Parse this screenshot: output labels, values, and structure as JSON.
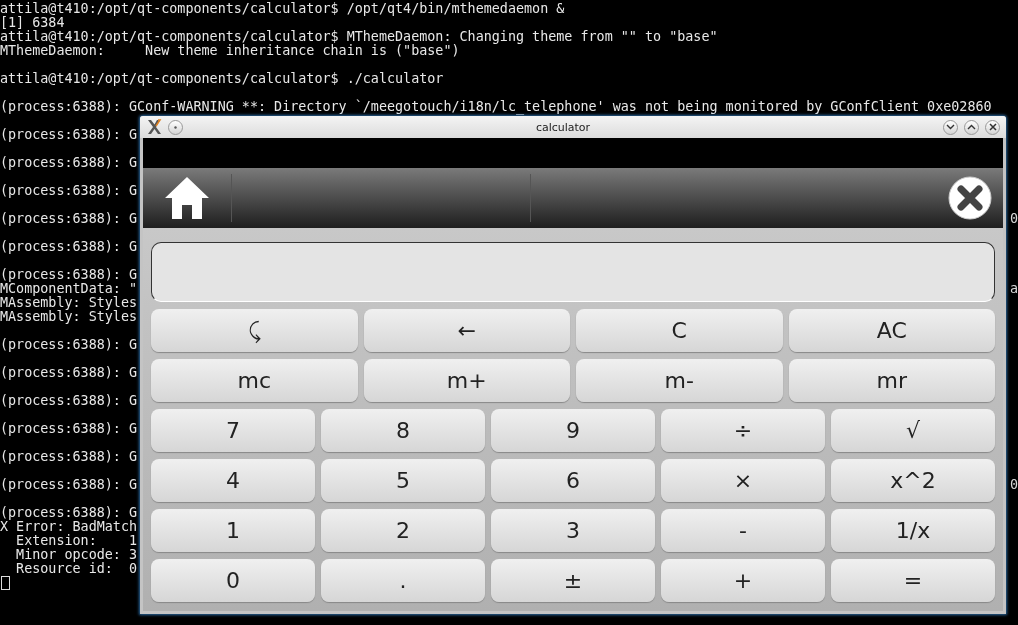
{
  "terminal": {
    "lines": [
      {
        "kind": "text",
        "text": "attila@t410:/opt/qt-components/calculator$ /opt/qt4/bin/mthemedaemon &"
      },
      {
        "kind": "text",
        "text": "[1] 6384"
      },
      {
        "kind": "text",
        "text": "attila@t410:/opt/qt-components/calculator$ MThemeDaemon: Changing theme from \"\" to \"base\""
      },
      {
        "kind": "text",
        "text": "MThemeDaemon:     New theme inheritance chain is (\"base\")"
      },
      {
        "kind": "blank"
      },
      {
        "kind": "text",
        "text": "attila@t410:/opt/qt-components/calculator$ ./calculator"
      },
      {
        "kind": "blank"
      },
      {
        "kind": "text",
        "text": "(process:6388): GConf-WARNING **: Directory `/meegotouch/i18n/lc_telephone' was not being monitored by GConfClient 0xe02860"
      },
      {
        "kind": "blank"
      },
      {
        "kind": "text",
        "text": "(process:6388): G"
      },
      {
        "kind": "blank"
      },
      {
        "kind": "text",
        "text": "(process:6388): G"
      },
      {
        "kind": "blank"
      },
      {
        "kind": "text",
        "text": "(process:6388): G"
      },
      {
        "kind": "blank"
      },
      {
        "kind": "text",
        "text": "(process:6388): G",
        "tail": "0"
      },
      {
        "kind": "blank"
      },
      {
        "kind": "text",
        "text": "(process:6388): G"
      },
      {
        "kind": "blank"
      },
      {
        "kind": "text",
        "text": "(process:6388): G"
      },
      {
        "kind": "text",
        "text": "MComponentData: \"",
        "tail": "a"
      },
      {
        "kind": "text",
        "text": "MAssembly: Styles"
      },
      {
        "kind": "text",
        "text": "MAssembly: Styles"
      },
      {
        "kind": "blank"
      },
      {
        "kind": "text",
        "text": "(process:6388): G"
      },
      {
        "kind": "blank"
      },
      {
        "kind": "text",
        "text": "(process:6388): G"
      },
      {
        "kind": "blank"
      },
      {
        "kind": "text",
        "text": "(process:6388): G"
      },
      {
        "kind": "blank"
      },
      {
        "kind": "text",
        "text": "(process:6388): G"
      },
      {
        "kind": "blank"
      },
      {
        "kind": "text",
        "text": "(process:6388): G"
      },
      {
        "kind": "blank"
      },
      {
        "kind": "text",
        "text": "(process:6388): G",
        "tail": "0"
      },
      {
        "kind": "blank"
      },
      {
        "kind": "text",
        "text": "(process:6388): G"
      },
      {
        "kind": "text",
        "text": "X Error: BadMatch"
      },
      {
        "kind": "text",
        "text": "  Extension:    1"
      },
      {
        "kind": "text",
        "text": "  Minor opcode: 3"
      },
      {
        "kind": "text",
        "text": "  Resource id:  0"
      },
      {
        "kind": "cursor"
      }
    ]
  },
  "window": {
    "title": "calculator"
  },
  "keypad": {
    "rows": [
      [
        "⤹",
        "←",
        "C",
        "AC"
      ],
      [
        "mc",
        "m+",
        "m-",
        "mr"
      ],
      [
        "7",
        "8",
        "9",
        "÷",
        "√"
      ],
      [
        "4",
        "5",
        "6",
        "×",
        "x^2"
      ],
      [
        "1",
        "2",
        "3",
        "-",
        "1/x"
      ],
      [
        "0",
        ".",
        "±",
        "+",
        "="
      ]
    ]
  }
}
